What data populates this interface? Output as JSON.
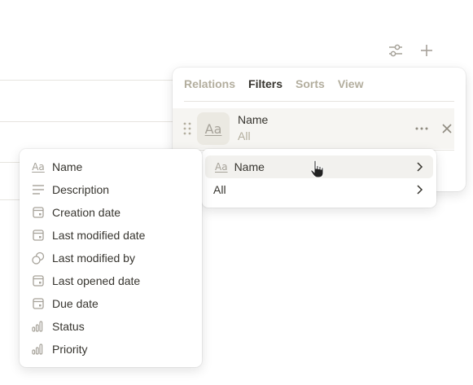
{
  "toolbar": {
    "filter_icon": "sliders-icon",
    "add_icon": "plus-icon"
  },
  "panel": {
    "tabs": [
      {
        "label": "Relations",
        "active": false
      },
      {
        "label": "Filters",
        "active": true
      },
      {
        "label": "Sorts",
        "active": false
      },
      {
        "label": "View",
        "active": false
      }
    ],
    "filter": {
      "type_glyph": "Aa",
      "property": "Name",
      "value": "All"
    }
  },
  "submenu": {
    "items": [
      {
        "type_glyph": "Aa",
        "label": "Name"
      },
      {
        "label": "All"
      }
    ]
  },
  "property_menu": {
    "items": [
      {
        "icon": "text-type-icon",
        "glyph": "Aa",
        "label": "Name"
      },
      {
        "icon": "lines-icon",
        "label": "Description"
      },
      {
        "icon": "calendar-icon",
        "label": "Creation date"
      },
      {
        "icon": "calendar-icon",
        "label": "Last modified date"
      },
      {
        "icon": "person-icon",
        "label": "Last modified by"
      },
      {
        "icon": "calendar-icon",
        "label": "Last opened date"
      },
      {
        "icon": "calendar-icon",
        "label": "Due date"
      },
      {
        "icon": "status-bars-icon",
        "label": "Status"
      },
      {
        "icon": "status-bars-icon",
        "label": "Priority"
      }
    ]
  },
  "colors": {
    "accent_muted": "#b3ae9e",
    "text": "#37352f",
    "chip_bg": "#ebe9e2"
  }
}
